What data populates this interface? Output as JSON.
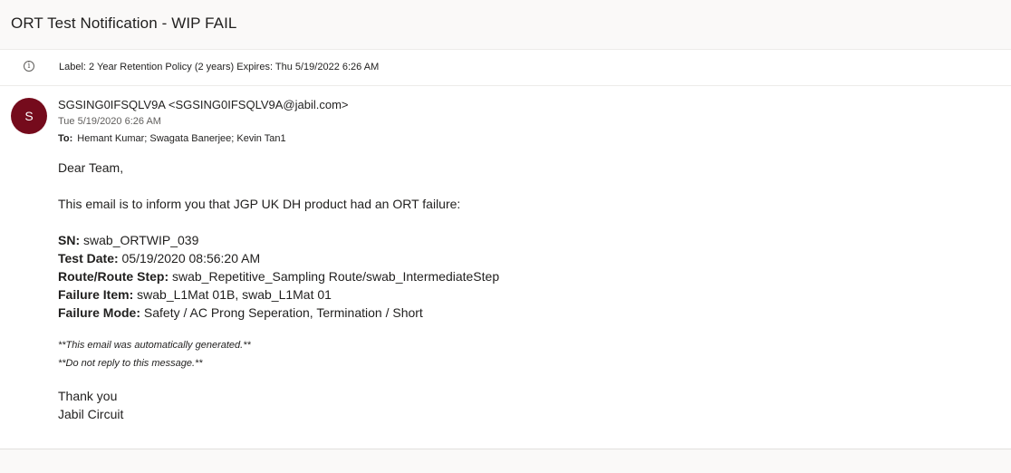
{
  "subject": "ORT Test Notification - WIP FAIL",
  "label": {
    "icon": "info-icon",
    "text": "Label: 2 Year Retention Policy (2 years) Expires: Thu 5/19/2022 6:26 AM"
  },
  "sender": {
    "initial": "S",
    "avatar_color": "#750b1c",
    "display": "SGSING0IFSQLV9A <SGSING0IFSQLV9A@jabil.com>",
    "date": "Tue 5/19/2020 6:26 AM",
    "to_label": "To:",
    "recipients": "Hemant Kumar; Swagata Banerjee; Kevin Tan1"
  },
  "body": {
    "greeting": "Dear Team,",
    "intro": "This email is to inform you that JGP UK DH product had an ORT failure:",
    "fields": [
      {
        "label": "SN:",
        "value": " swab_ORTWIP_039"
      },
      {
        "label": "Test Date:",
        "value": " 05/19/2020 08:56:20 AM"
      },
      {
        "label": "Route/Route Step:",
        "value": " swab_Repetitive_Sampling Route/swab_IntermediateStep"
      },
      {
        "label": "Failure Item:",
        "value": " swab_L1Mat 01B, swab_L1Mat 01"
      },
      {
        "label": "Failure Mode:",
        "value": " Safety / AC Prong Seperation, Termination / Short"
      }
    ],
    "notes": [
      "**This email was automatically generated.**",
      "**Do not reply to this message.**"
    ],
    "closing": "Thank you",
    "signature": "Jabil Circuit"
  }
}
